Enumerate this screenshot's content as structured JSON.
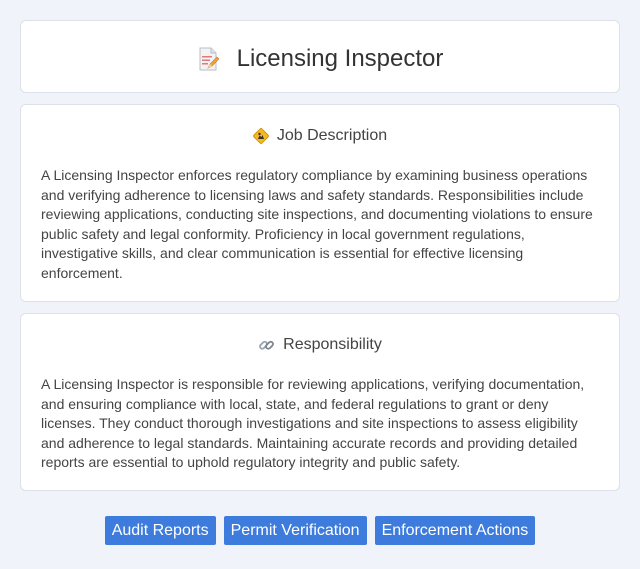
{
  "header": {
    "title": "Licensing Inspector",
    "icon": "document-pencil-icon"
  },
  "description": {
    "title": "Job Description",
    "icon": "construction-sign-icon",
    "text": "A Licensing Inspector enforces regulatory compliance by examining business operations and verifying adherence to licensing laws and safety standards. Responsibilities include reviewing applications, conducting site inspections, and documenting violations to ensure public safety and legal conformity. Proficiency in local government regulations, investigative skills, and clear communication is essential for effective licensing enforcement."
  },
  "responsibility": {
    "title": "Responsibility",
    "icon": "link-icon",
    "text": "A Licensing Inspector is responsible for reviewing applications, verifying documentation, and ensuring compliance with local, state, and federal regulations to grant or deny licenses. They conduct thorough investigations and site inspections to assess eligibility and adherence to legal standards. Maintaining accurate records and providing detailed reports are essential to uphold regulatory integrity and public safety."
  },
  "tags": [
    {
      "label": "Audit Reports"
    },
    {
      "label": "Permit Verification"
    },
    {
      "label": "Enforcement Actions"
    }
  ],
  "colors": {
    "background": "#f0f3f9",
    "card": "#ffffff",
    "tag": "#3d7bdc"
  }
}
